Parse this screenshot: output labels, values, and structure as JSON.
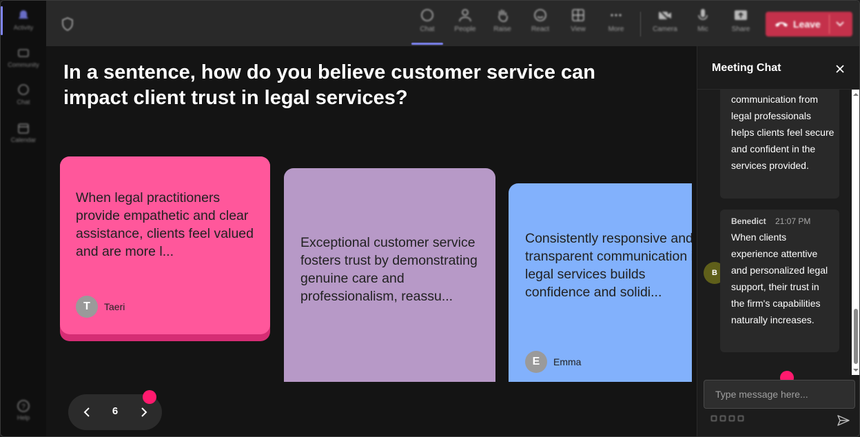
{
  "rail": {
    "items": [
      {
        "label": "Activity",
        "icon": "bell-icon"
      },
      {
        "label": "Community",
        "icon": "community-icon"
      },
      {
        "label": "Chat",
        "icon": "chat-icon"
      },
      {
        "label": "Calendar",
        "icon": "calendar-icon"
      },
      {
        "label": "Help",
        "icon": "help-icon"
      }
    ]
  },
  "toolbar": {
    "buttons": [
      {
        "label": "Chat",
        "icon": "chat-icon"
      },
      {
        "label": "People",
        "icon": "people-icon"
      },
      {
        "label": "Raise",
        "icon": "hand-icon"
      },
      {
        "label": "React",
        "icon": "smiley-icon"
      },
      {
        "label": "View",
        "icon": "grid-icon"
      },
      {
        "label": "More",
        "icon": "more-icon"
      },
      {
        "label": "Camera",
        "icon": "camera-off-icon"
      },
      {
        "label": "Mic",
        "icon": "mic-icon"
      },
      {
        "label": "Share",
        "icon": "share-icon"
      }
    ],
    "leave_label": "Leave"
  },
  "stage": {
    "question": "In a sentence, how do you believe customer service can impact client trust in legal services?",
    "cards": [
      {
        "text": "When legal practitioners provide empathetic and clear assistance, clients feel valued and are more l...",
        "author": "Taeri",
        "initial": "T",
        "color": "#ff579b"
      },
      {
        "text": "Exceptional customer service fosters trust by demonstrating genuine care and professionalism, reassu...",
        "author": "",
        "initial": "",
        "color": "#b799c7"
      },
      {
        "text": "Consistently responsive and transparent communication in legal services builds confidence and solidi...",
        "author": "Emma",
        "initial": "E",
        "color": "#82b1fc"
      }
    ],
    "page": "6"
  },
  "chat": {
    "title": "Meeting Chat",
    "messages": [
      {
        "sender": "",
        "time": "",
        "text": "communication from legal professionals helps clients feel secure and confident in the services provided."
      },
      {
        "sender": "Benedict",
        "initial": "B",
        "time": "21:07 PM",
        "text": "When clients experience attentive and personalized legal support, their trust in the firm's capabilities naturally increases."
      }
    ],
    "input_placeholder": "Type message here..."
  },
  "colors": {
    "accent": "#7f85f5",
    "leave": "#c4314b",
    "notify": "#ff1a6e"
  }
}
